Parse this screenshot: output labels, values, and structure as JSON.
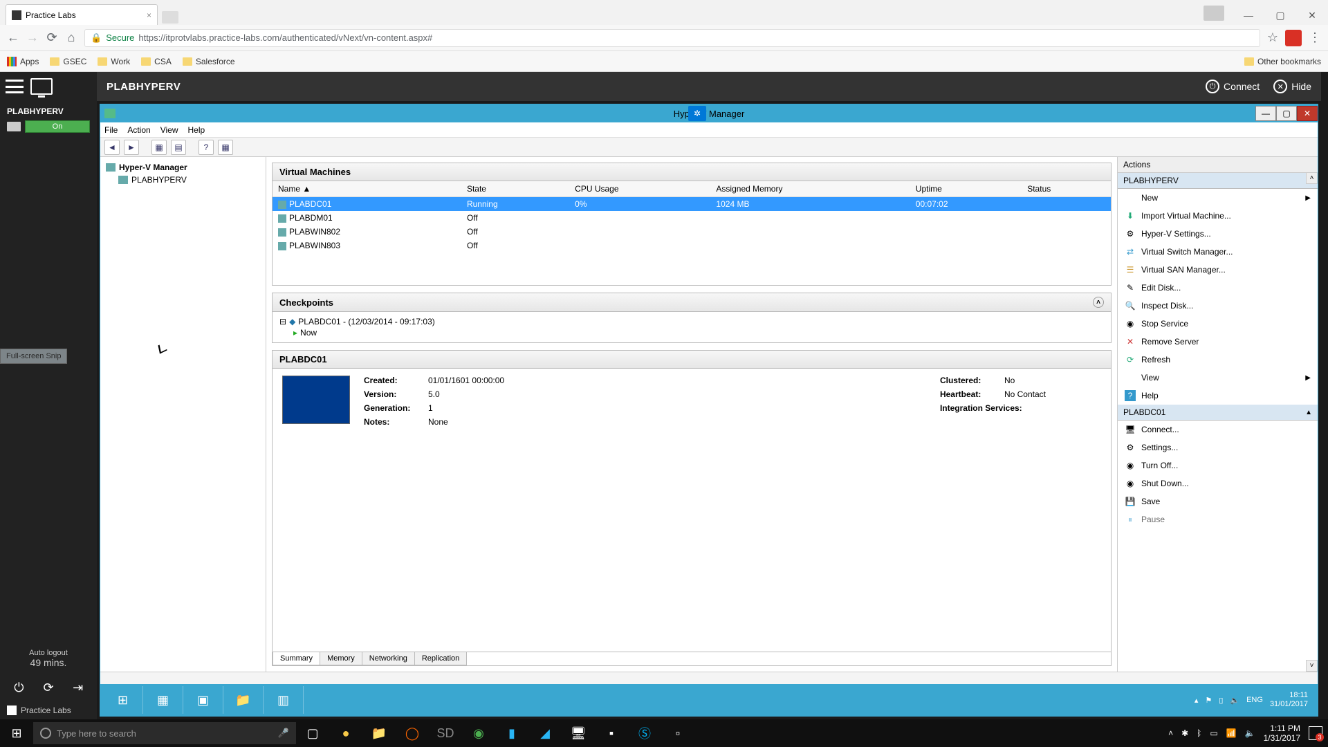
{
  "browser": {
    "tab_title": "Practice Labs",
    "secure_label": "Secure",
    "url": "https://itprotvlabs.practice-labs.com/authenticated/vNext/vn-content.aspx#",
    "bookmarks": {
      "apps": "Apps",
      "items": [
        "GSEC",
        "Work",
        "CSA",
        "Salesforce"
      ],
      "other": "Other bookmarks"
    }
  },
  "lab_sidebar": {
    "machine_name": "PLABHYPERV",
    "status": "On",
    "autologout_label": "Auto logout",
    "autologout_time": "49 mins.",
    "brand": "Practice Labs",
    "hint": "Full-screen Snip"
  },
  "lab_header": {
    "title": "PLABHYPERV",
    "connect": "Connect",
    "hide": "Hide"
  },
  "hyperv": {
    "window_title": "Hyper-V Manager",
    "menu": {
      "file": "File",
      "action": "Action",
      "view": "View",
      "help": "Help"
    },
    "tree": {
      "root": "Hyper-V Manager",
      "host": "PLABHYPERV"
    },
    "vms": {
      "title": "Virtual Machines",
      "cols": {
        "name": "Name",
        "state": "State",
        "cpu": "CPU Usage",
        "memory": "Assigned Memory",
        "uptime": "Uptime",
        "status": "Status"
      },
      "rows": [
        {
          "name": "PLABDC01",
          "state": "Running",
          "cpu": "0%",
          "memory": "1024 MB",
          "uptime": "00:07:02",
          "status": ""
        },
        {
          "name": "PLABDM01",
          "state": "Off",
          "cpu": "",
          "memory": "",
          "uptime": "",
          "status": ""
        },
        {
          "name": "PLABWIN802",
          "state": "Off",
          "cpu": "",
          "memory": "",
          "uptime": "",
          "status": ""
        },
        {
          "name": "PLABWIN803",
          "state": "Off",
          "cpu": "",
          "memory": "",
          "uptime": "",
          "status": ""
        }
      ]
    },
    "checkpoints": {
      "title": "Checkpoints",
      "entry": "PLABDC01 - (12/03/2014 - 09:17:03)",
      "now": "Now"
    },
    "details": {
      "title": "PLABDC01",
      "created_l": "Created:",
      "created_v": "01/01/1601 00:00:00",
      "version_l": "Version:",
      "version_v": "5.0",
      "generation_l": "Generation:",
      "generation_v": "1",
      "notes_l": "Notes:",
      "notes_v": "None",
      "clustered_l": "Clustered:",
      "clustered_v": "No",
      "heartbeat_l": "Heartbeat:",
      "heartbeat_v": "No Contact",
      "integration_l": "Integration Services:",
      "tabs": {
        "summary": "Summary",
        "memory": "Memory",
        "networking": "Networking",
        "replication": "Replication"
      }
    },
    "actions": {
      "panel_title": "Actions",
      "host_group": "PLABHYPERV",
      "host_items": {
        "new": "New",
        "import": "Import Virtual Machine...",
        "settings": "Hyper-V Settings...",
        "vswitch": "Virtual Switch Manager...",
        "vsan": "Virtual SAN Manager...",
        "editdisk": "Edit Disk...",
        "inspectdisk": "Inspect Disk...",
        "stopservice": "Stop Service",
        "removeserver": "Remove Server",
        "refresh": "Refresh",
        "view": "View",
        "help": "Help"
      },
      "vm_group": "PLABDC01",
      "vm_items": {
        "connect": "Connect...",
        "settings": "Settings...",
        "turnoff": "Turn Off...",
        "shutdown": "Shut Down...",
        "save": "Save",
        "pause": "Pause"
      }
    }
  },
  "inner_taskbar": {
    "lang": "ENG",
    "time": "18:11",
    "date": "31/01/2017"
  },
  "host_taskbar": {
    "search_placeholder": "Type here to search",
    "time": "1:11 PM",
    "date": "1/31/2017",
    "notif_count": "3"
  }
}
